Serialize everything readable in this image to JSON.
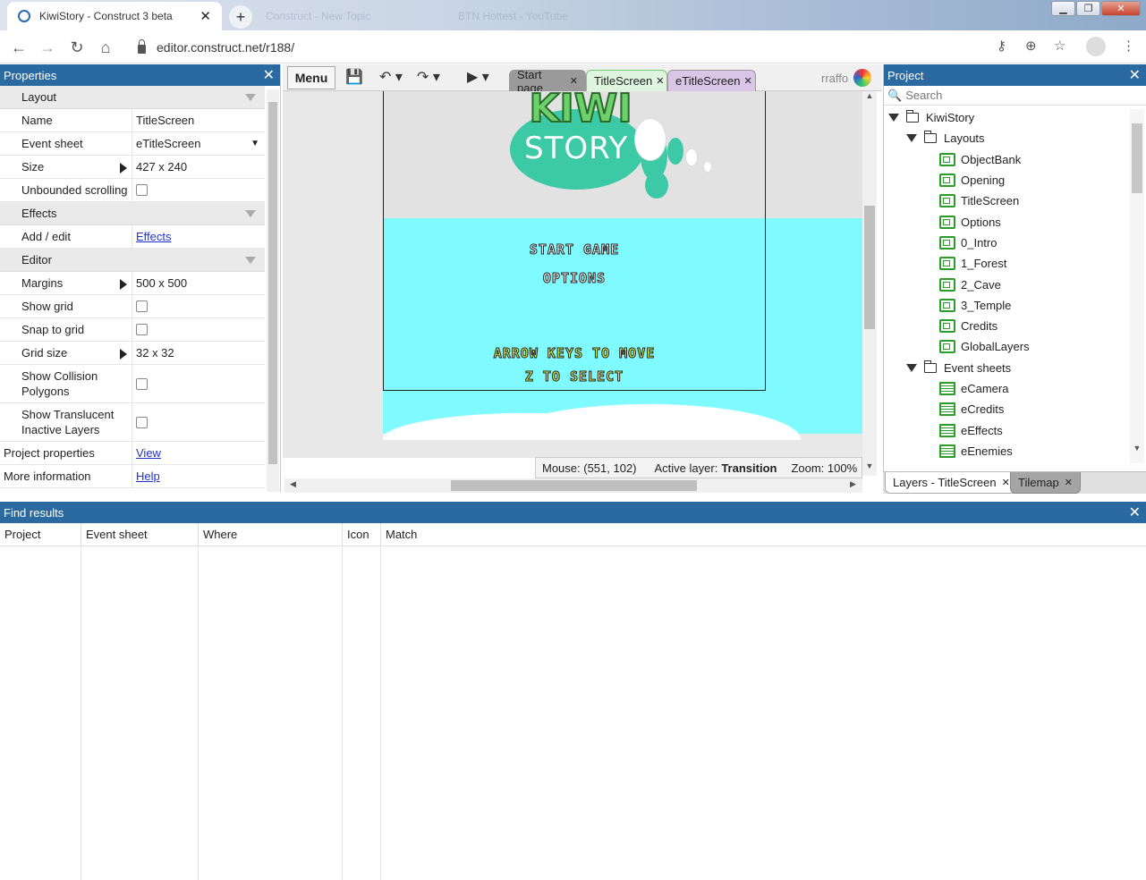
{
  "browser": {
    "tab_title": "KiwiStory - Construct 3 beta",
    "ghost_tabs": [
      "Construct - New Topic",
      "BTN Hottest - YouTube"
    ],
    "url": "editor.construct.net/r188/"
  },
  "properties": {
    "title": "Properties",
    "sections": {
      "layout": "Layout",
      "effects": "Effects",
      "editor": "Editor"
    },
    "rows": {
      "name": {
        "label": "Name",
        "value": "TitleScreen"
      },
      "event_sheet": {
        "label": "Event sheet",
        "value": "eTitleScreen"
      },
      "size": {
        "label": "Size",
        "value": "427 x 240"
      },
      "unbounded": {
        "label": "Unbounded scrolling"
      },
      "add_edit": {
        "label": "Add / edit",
        "value": "Effects"
      },
      "margins": {
        "label": "Margins",
        "value": "500 x 500"
      },
      "show_grid": {
        "label": "Show grid"
      },
      "snap_grid": {
        "label": "Snap to grid"
      },
      "grid_size": {
        "label": "Grid size",
        "value": "32 x 32"
      },
      "show_collision": {
        "label": "Show Collision Polygons"
      },
      "show_translucent": {
        "label": "Show Translucent Inactive Layers"
      },
      "project_props": {
        "label": "Project properties",
        "value": "View"
      },
      "more_info": {
        "label": "More information",
        "value": "Help"
      }
    }
  },
  "toolbar": {
    "menu": "Menu",
    "tabs": [
      "Start page",
      "TitleScreen",
      "eTitleScreen"
    ],
    "user": "rraffo"
  },
  "canvas": {
    "logo_top": "KIWI",
    "logo_bottom": "STORY",
    "menu_items": [
      "START GAME",
      "OPTIONS"
    ],
    "hint_lines": [
      "ARROW KEYS TO MOVE",
      "Z TO SELECT"
    ]
  },
  "status": {
    "mouse": "Mouse: (551, 102)",
    "layer_label": "Active layer:",
    "layer_value": "Transition",
    "zoom": "Zoom: 100%"
  },
  "project": {
    "title": "Project",
    "search_placeholder": "Search",
    "root": "KiwiStory",
    "layouts_folder": "Layouts",
    "layouts": [
      "ObjectBank",
      "Opening",
      "TitleScreen",
      "Options",
      "0_Intro",
      "1_Forest",
      "2_Cave",
      "3_Temple",
      "Credits",
      "GlobalLayers"
    ],
    "events_folder": "Event sheets",
    "event_sheets": [
      "eCamera",
      "eCredits",
      "eEffects",
      "eEnemies"
    ],
    "bottom_tabs": [
      "Layers - TitleScreen",
      "Tilemap"
    ]
  },
  "find": {
    "title": "Find results",
    "columns": [
      "Project",
      "Event sheet",
      "Where",
      "Icon",
      "Match"
    ]
  },
  "colors": {
    "panel_header": "#2a6aa0",
    "sky": "#7ffaff",
    "active_tab": "#dff5df",
    "event_tab": "#d9c6e6"
  }
}
